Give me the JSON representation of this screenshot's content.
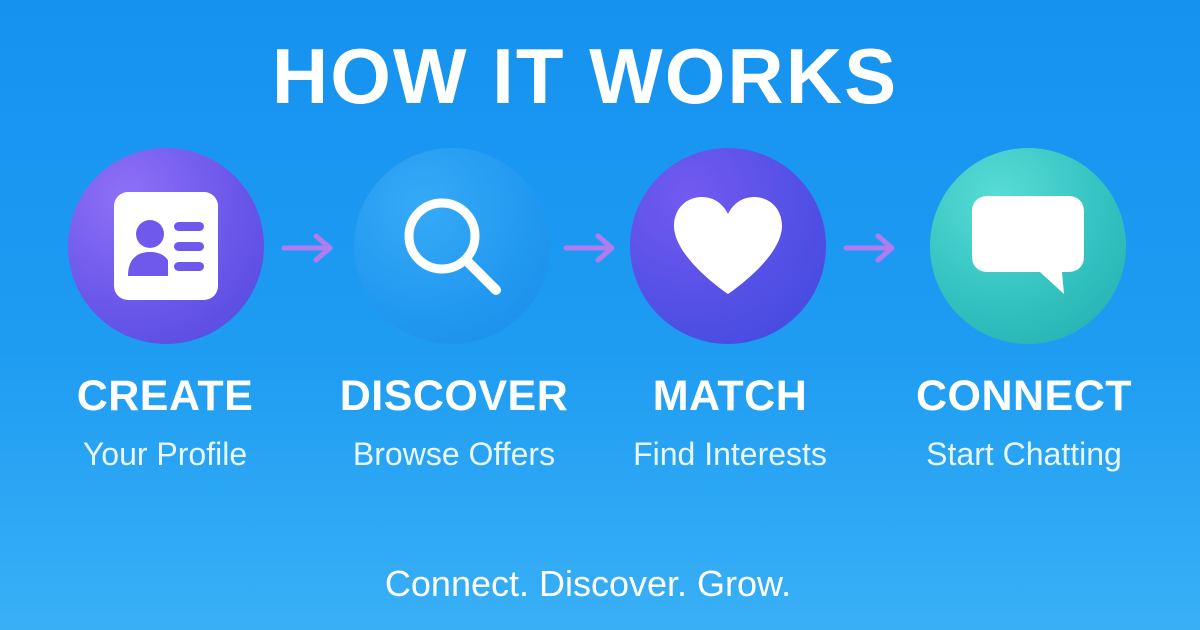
{
  "header": {
    "title": "HOW IT WORKS"
  },
  "steps": [
    {
      "title": "CREATE",
      "subtitle": "Your Profile",
      "icon": "profile-card-icon",
      "gradient": [
        "#8a6cf6",
        "#5a4fe0"
      ]
    },
    {
      "title": "DISCOVER",
      "subtitle": "Browse Offers",
      "icon": "search-icon",
      "gradient": [
        "#2aa3f6",
        "#1c8cec"
      ]
    },
    {
      "title": "MATCH",
      "subtitle": "Find Interests",
      "icon": "heart-icon",
      "gradient": [
        "#6b56ea",
        "#3d49de"
      ]
    },
    {
      "title": "CONNECT",
      "subtitle": "Start Chatting",
      "icon": "chat-bubble-icon",
      "gradient": [
        "#4fd6d0",
        "#22b3b0"
      ]
    }
  ],
  "arrow_color": "#b27cf0",
  "footer": {
    "tagline": "Connect. Discover. Grow."
  }
}
